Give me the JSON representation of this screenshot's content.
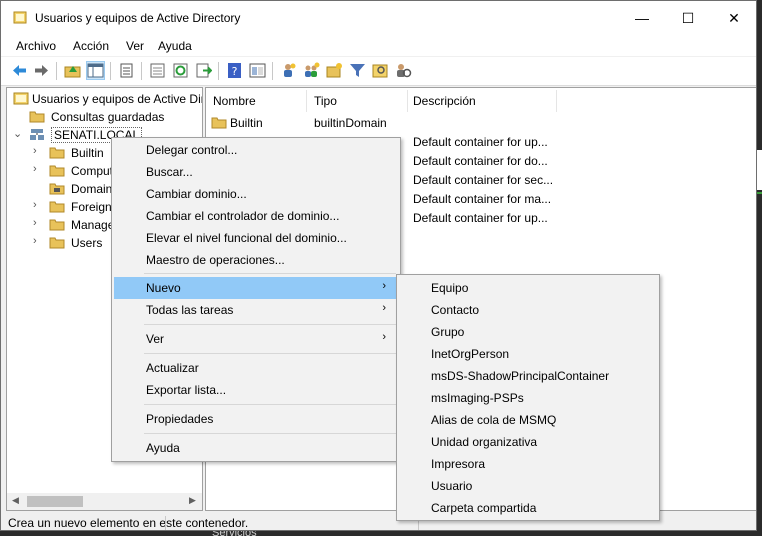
{
  "window": {
    "title": "Usuarios y equipos de Active Directory",
    "controls": {
      "minimize": "—",
      "maximize": "☐",
      "close": "✕"
    }
  },
  "menubar": [
    "Archivo",
    "Acción",
    "Ver",
    "Ayuda"
  ],
  "toolbar": {
    "icons": [
      "back-arrow-icon",
      "forward-arrow-icon",
      "up-folder-icon",
      "show-tree-icon",
      "properties-icon",
      "export-list-icon",
      "refresh-icon",
      "export-icon",
      "help-icon",
      "console-view-icon",
      "add-user-icon",
      "add-group-icon",
      "add-ou-icon",
      "filter-icon",
      "find-icon",
      "delegate-icon"
    ]
  },
  "tree": {
    "root": "Usuarios y equipos de Active Directory",
    "saved_queries": "Consultas guardadas",
    "domain": "SENATI.LOCAL",
    "children": [
      "Builtin",
      "Computers",
      "Domain Controllers",
      "ForeignSecurityPrincipals",
      "Managed Service Accounts",
      "Users"
    ]
  },
  "list": {
    "columns": [
      "Nombre",
      "Tipo",
      "Descripción"
    ],
    "rows": [
      {
        "name": "Builtin",
        "type": "builtinDomain",
        "desc": ""
      },
      {
        "name": "",
        "type": "",
        "desc": "Default container for up..."
      },
      {
        "name": "",
        "type": "",
        "desc": "Default container for do..."
      },
      {
        "name": "",
        "type": "",
        "desc": "Default container for sec..."
      },
      {
        "name": "",
        "type": "",
        "desc": "Default container for ma..."
      },
      {
        "name": "",
        "type": "",
        "desc": "Default container for up..."
      }
    ]
  },
  "context_menu": {
    "items": [
      {
        "label": "Delegar control..."
      },
      {
        "label": "Buscar..."
      },
      {
        "label": "Cambiar dominio..."
      },
      {
        "label": "Cambiar el controlador de dominio..."
      },
      {
        "label": "Elevar el nivel funcional del dominio..."
      },
      {
        "label": "Maestro de operaciones..."
      },
      {
        "label": "Nuevo",
        "submenu": true,
        "highlighted": true
      },
      {
        "label": "Todas las tareas",
        "submenu": true
      },
      {
        "label": "Ver",
        "submenu": true
      },
      {
        "label": "Actualizar"
      },
      {
        "label": "Exportar lista..."
      },
      {
        "label": "Propiedades"
      },
      {
        "label": "Ayuda"
      }
    ],
    "arrow_glyph": "›"
  },
  "submenu_nuevo": {
    "items": [
      "Equipo",
      "Contacto",
      "Grupo",
      "InetOrgPerson",
      "msDS-ShadowPrincipalContainer",
      "msImaging-PSPs",
      "Alias de cola de MSMQ",
      "Unidad organizativa",
      "Impresora",
      "Usuario",
      "Carpeta compartida"
    ]
  },
  "status_bar": {
    "text": "Crea un nuevo elemento en este contenedor."
  },
  "background_peek": {
    "text": "Servicios"
  },
  "colors": {
    "highlight": "#91c9f7",
    "folder": "#e8c25a",
    "title_bg": "#ffffff"
  }
}
